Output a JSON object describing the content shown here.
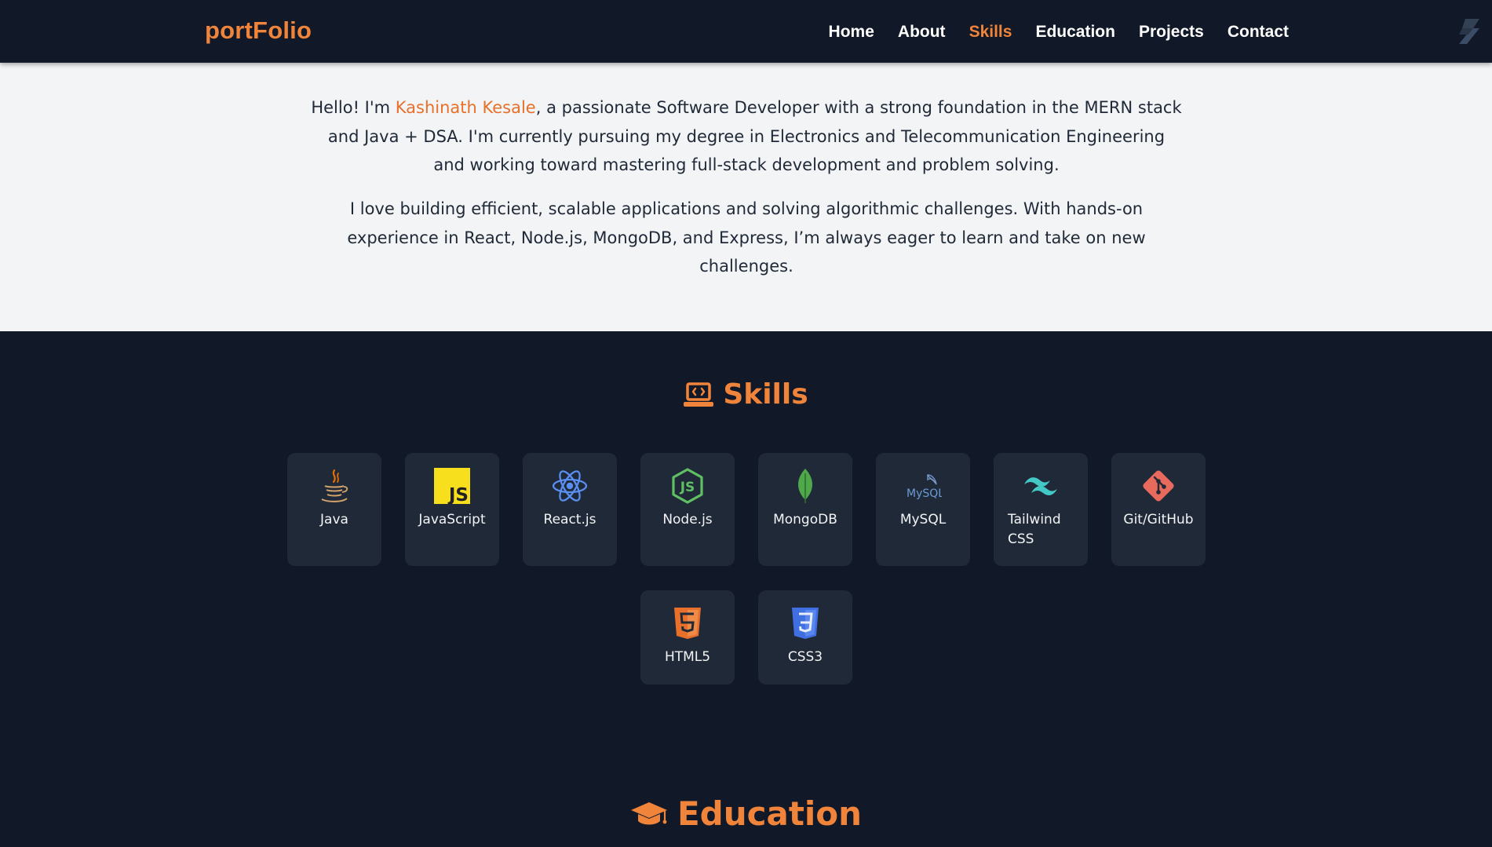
{
  "nav": {
    "logo": "portFolio",
    "links": [
      "Home",
      "About",
      "Skills",
      "Education",
      "Projects",
      "Contact"
    ],
    "active": "Skills"
  },
  "about": {
    "p1_prefix": "Hello! I'm ",
    "name": "Kashinath Kesale",
    "p1_suffix": ", a passionate Software Developer with a strong foundation in the MERN stack and Java + DSA. I'm currently pursuing my degree in Electronics and Telecommunication Engineering and working toward mastering full-stack development and problem solving.",
    "p2": "I love building efficient, scalable applications and solving algorithmic challenges. With hands-on experience in React, Node.js, MongoDB, and Express, I’m always eager to learn and take on new challenges."
  },
  "skills": {
    "title": "Skills",
    "items": [
      {
        "label": "Java",
        "icon": "java-icon"
      },
      {
        "label": "JavaScript",
        "icon": "javascript-icon"
      },
      {
        "label": "React.js",
        "icon": "react-icon"
      },
      {
        "label": "Node.js",
        "icon": "nodejs-icon"
      },
      {
        "label": "MongoDB",
        "icon": "mongodb-icon"
      },
      {
        "label": "MySQL",
        "icon": "mysql-icon"
      },
      {
        "label": "Tailwind CSS",
        "icon": "tailwind-icon"
      },
      {
        "label": "Git/GitHub",
        "icon": "git-icon"
      },
      {
        "label": "HTML5",
        "icon": "html5-icon"
      },
      {
        "label": "CSS3",
        "icon": "css3-icon"
      }
    ]
  },
  "education": {
    "title": "Education"
  },
  "colors": {
    "accent": "#f0843a",
    "dark_bg": "#111827",
    "card_bg": "#1f2937",
    "light_bg": "#f3f4f6"
  }
}
